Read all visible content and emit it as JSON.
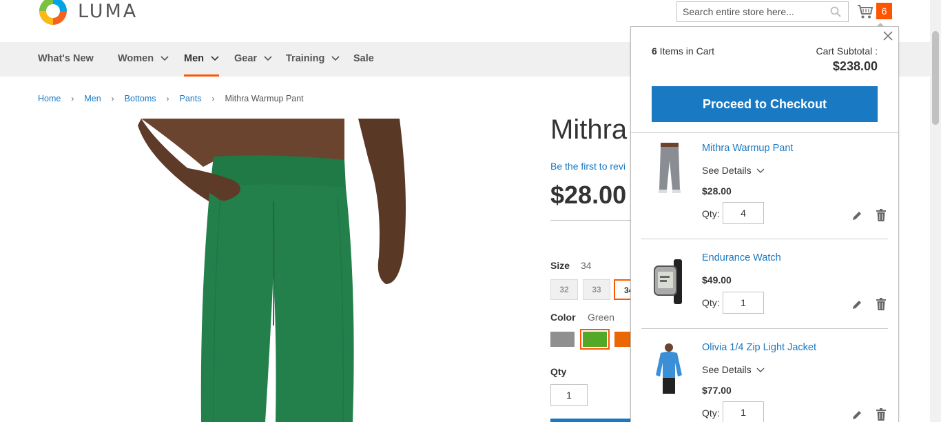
{
  "header": {
    "logo_text": "LUMA",
    "search_placeholder": "Search entire store here...",
    "cart_count": "6"
  },
  "nav": {
    "items": [
      {
        "label": "What's New",
        "has_dropdown": false
      },
      {
        "label": "Women",
        "has_dropdown": true
      },
      {
        "label": "Men",
        "has_dropdown": true,
        "active": true
      },
      {
        "label": "Gear",
        "has_dropdown": true
      },
      {
        "label": "Training",
        "has_dropdown": true
      },
      {
        "label": "Sale",
        "has_dropdown": false
      }
    ]
  },
  "breadcrumbs": {
    "items": [
      "Home",
      "Men",
      "Bottoms",
      "Pants"
    ],
    "separator": "›",
    "current": "Mithra Warmup Pant"
  },
  "product": {
    "title": "Mithra",
    "review_link": "Be the first to revi",
    "price": "$28.00",
    "size_label": "Size",
    "size_selected": "34",
    "sizes": [
      "32",
      "33",
      "34"
    ],
    "color_label": "Color",
    "color_selected": "Green",
    "colors": [
      {
        "name": "Gray",
        "hex": "#8f8f8f"
      },
      {
        "name": "Green",
        "hex": "#53a828"
      },
      {
        "name": "Orange",
        "hex": "#eb6703"
      }
    ],
    "qty_label": "Qty",
    "qty_value": "1"
  },
  "minicart": {
    "items_count": "6",
    "items_label": " Items in Cart",
    "subtotal_label": "Cart Subtotal :",
    "subtotal_value": "$238.00",
    "checkout_label": "Proceed to Checkout",
    "items": [
      {
        "name": "Mithra Warmup Pant",
        "see_details": "See Details",
        "price": "$28.00",
        "qty_label": "Qty:",
        "qty": "4"
      },
      {
        "name": "Endurance Watch",
        "see_details": "",
        "price": "$49.00",
        "qty_label": "Qty:",
        "qty": "1"
      },
      {
        "name": "Olivia 1/4 Zip Light Jacket",
        "see_details": "See Details",
        "price": "$77.00",
        "qty_label": "Qty:",
        "qty": "1"
      }
    ]
  },
  "colors": {
    "accent": "#ff5501",
    "link": "#1979c3",
    "button": "#1979c3",
    "nav_bg": "#f0f0f0"
  }
}
